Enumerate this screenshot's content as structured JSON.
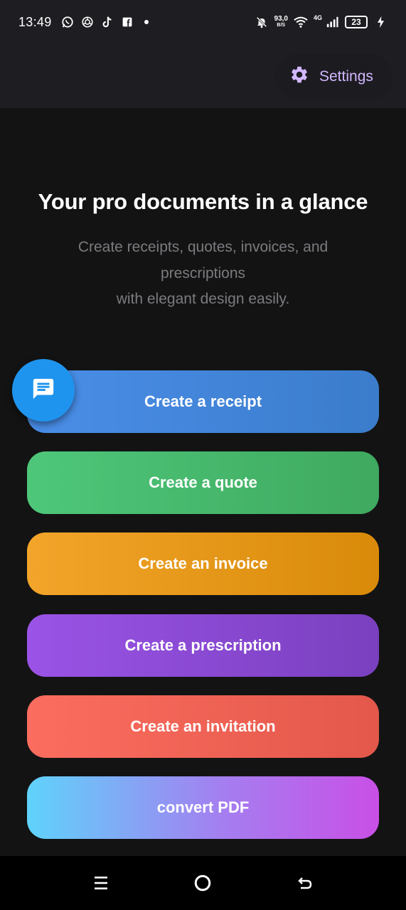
{
  "status_bar": {
    "time": "13:49",
    "net_speed": "93,0",
    "net_speed_unit": "B/S",
    "network_type": "4G",
    "battery": "23",
    "left_icons": [
      "whatsapp-icon",
      "chatgpt-icon",
      "tiktok-icon",
      "facebook-icon",
      "notification-dot"
    ],
    "right_icons": [
      "mute-notifications-icon",
      "wifi-icon",
      "signal-icon",
      "battery-icon",
      "charging-icon"
    ]
  },
  "header": {
    "settings_label": "Settings",
    "settings_icon": "gear-icon",
    "accent": "#d2b8ff"
  },
  "hero": {
    "title": "Your pro documents in a glance",
    "subtitle": "Create receipts, quotes, invoices, and prescriptions\nwith elegant design easily."
  },
  "actions": [
    {
      "label": "Create a receipt",
      "color": "#4a8ee8"
    },
    {
      "label": "Create a quote",
      "color": "#4ec77a"
    },
    {
      "label": "Create an invoice",
      "color": "#f2a52a"
    },
    {
      "label": "Create a prescription",
      "color": "#9a53e6"
    },
    {
      "label": "Create an invitation",
      "color": "#fb6d5f"
    },
    {
      "label": "convert PDF",
      "color": "#5fd3fb"
    }
  ],
  "fab": {
    "icon": "chat-message-icon",
    "color": "#1f94ee"
  },
  "nav_bar": {
    "icons": [
      "menu-icon",
      "home-icon",
      "back-icon"
    ]
  }
}
